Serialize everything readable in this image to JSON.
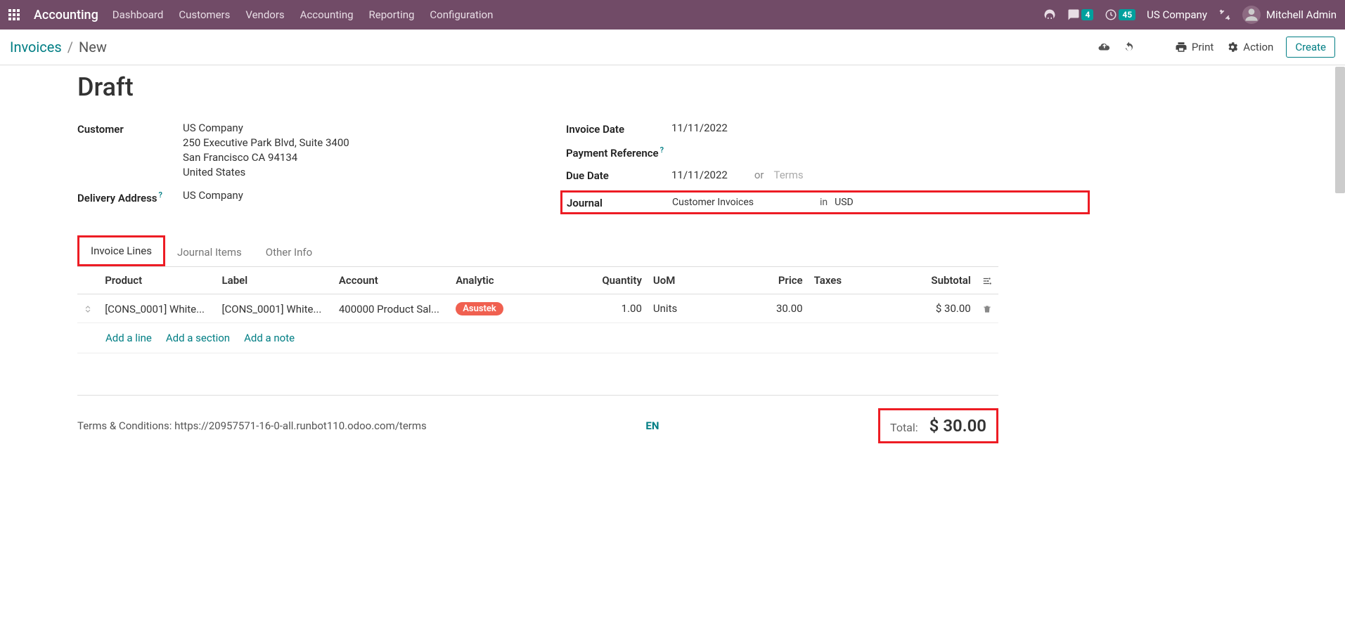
{
  "topbar": {
    "app_title": "Accounting",
    "nav": [
      "Dashboard",
      "Customers",
      "Vendors",
      "Accounting",
      "Reporting",
      "Configuration"
    ],
    "msg_badge": "4",
    "activity_badge": "45",
    "company": "US Company",
    "user": "Mitchell Admin"
  },
  "breadcrumb": {
    "parent": "Invoices",
    "current": "New"
  },
  "actions": {
    "print": "Print",
    "action": "Action",
    "create": "Create"
  },
  "form": {
    "title": "Draft",
    "left": {
      "customer_label": "Customer",
      "customer_name": "US Company",
      "addr1": "250 Executive Park Blvd, Suite 3400",
      "addr2": "San Francisco CA 94134",
      "addr3": "United States",
      "delivery_label": "Delivery Address",
      "delivery_value": "US Company"
    },
    "right": {
      "invoice_date_label": "Invoice Date",
      "invoice_date": "11/11/2022",
      "payment_ref_label": "Payment Reference",
      "due_date_label": "Due Date",
      "due_date": "11/11/2022",
      "due_or": "or",
      "terms_placeholder": "Terms",
      "journal_label": "Journal",
      "journal_value": "Customer Invoices",
      "journal_in": "in",
      "journal_currency": "USD"
    }
  },
  "tabs": {
    "t1": "Invoice Lines",
    "t2": "Journal Items",
    "t3": "Other Info"
  },
  "table": {
    "headers": {
      "product": "Product",
      "label": "Label",
      "account": "Account",
      "analytic": "Analytic",
      "quantity": "Quantity",
      "uom": "UoM",
      "price": "Price",
      "taxes": "Taxes",
      "subtotal": "Subtotal"
    },
    "row": {
      "product": "[CONS_0001] White...",
      "label": "[CONS_0001] White...",
      "account": "400000 Product Sal...",
      "analytic": "Asustek",
      "qty": "1.00",
      "uom": "Units",
      "price": "30.00",
      "subtotal": "$ 30.00"
    },
    "actions": {
      "add_line": "Add a line",
      "add_section": "Add a section",
      "add_note": "Add a note"
    }
  },
  "footer": {
    "terms": "Terms & Conditions: https://20957571-16-0-all.runbot110.odoo.com/terms",
    "lang": "EN",
    "total_label": "Total:",
    "total_amount": "$ 30.00"
  }
}
